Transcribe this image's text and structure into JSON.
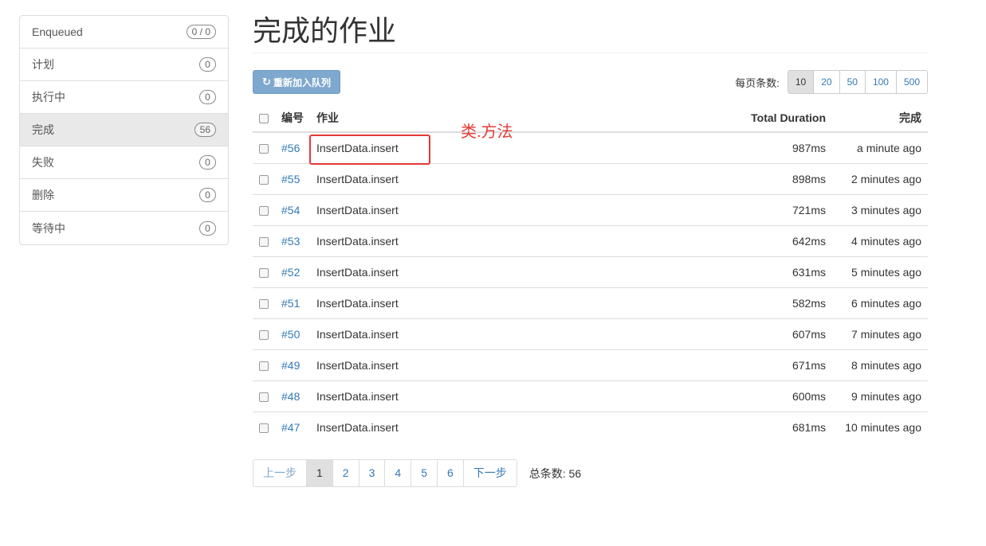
{
  "sidebar": {
    "items": [
      {
        "label": "Enqueued",
        "count": "0 / 0"
      },
      {
        "label": "计划",
        "count": "0"
      },
      {
        "label": "执行中",
        "count": "0"
      },
      {
        "label": "完成",
        "count": "56"
      },
      {
        "label": "失败",
        "count": "0"
      },
      {
        "label": "删除",
        "count": "0"
      },
      {
        "label": "等待中",
        "count": "0"
      }
    ]
  },
  "main": {
    "title": "完成的作业",
    "requeue_label": "重新加入队列",
    "perpage_label": "每页条数:",
    "perpage_options": [
      "10",
      "20",
      "50",
      "100",
      "500"
    ],
    "table": {
      "headers": {
        "id": "编号",
        "job": "作业",
        "duration": "Total Duration",
        "done": "完成"
      },
      "rows": [
        {
          "id": "#56",
          "job": "InsertData.insert",
          "duration": "987ms",
          "done": "a minute ago"
        },
        {
          "id": "#55",
          "job": "InsertData.insert",
          "duration": "898ms",
          "done": "2 minutes ago"
        },
        {
          "id": "#54",
          "job": "InsertData.insert",
          "duration": "721ms",
          "done": "3 minutes ago"
        },
        {
          "id": "#53",
          "job": "InsertData.insert",
          "duration": "642ms",
          "done": "4 minutes ago"
        },
        {
          "id": "#52",
          "job": "InsertData.insert",
          "duration": "631ms",
          "done": "5 minutes ago"
        },
        {
          "id": "#51",
          "job": "InsertData.insert",
          "duration": "582ms",
          "done": "6 minutes ago"
        },
        {
          "id": "#50",
          "job": "InsertData.insert",
          "duration": "607ms",
          "done": "7 minutes ago"
        },
        {
          "id": "#49",
          "job": "InsertData.insert",
          "duration": "671ms",
          "done": "8 minutes ago"
        },
        {
          "id": "#48",
          "job": "InsertData.insert",
          "duration": "600ms",
          "done": "9 minutes ago"
        },
        {
          "id": "#47",
          "job": "InsertData.insert",
          "duration": "681ms",
          "done": "10 minutes ago"
        }
      ]
    },
    "annotation": "类.方法",
    "pager": {
      "prev": "上一步",
      "pages": [
        "1",
        "2",
        "3",
        "4",
        "5",
        "6"
      ],
      "next": "下一步",
      "total": "总条数: 56"
    }
  },
  "colors": {
    "link": "#337ab7",
    "primary_button": "#7fa8ce",
    "annotation": "#e53935"
  },
  "icons": {
    "requeue": "refresh-icon"
  }
}
